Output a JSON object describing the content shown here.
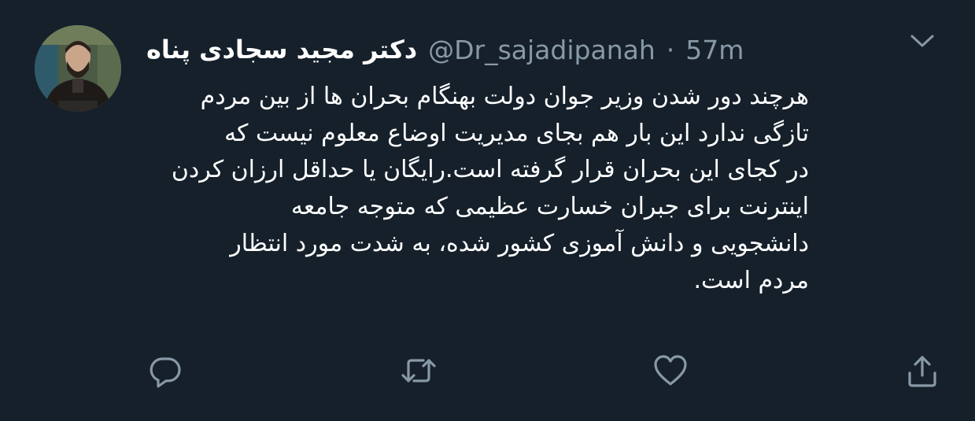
{
  "tweet": {
    "display_name": "دکتر مجید سجادی پناه",
    "handle": "@Dr_sajadipanah",
    "separator": "·",
    "time": "57m",
    "text": "هرچند دور شدن وزیر جوان دولت بهنگام بحران ها از بین مردم\nتازگی ندارد این بار هم بجای مدیریت اوضاع معلوم نیست که\nدر کجای این بحران قرار گرفته است.رایگان یا حداقل ارزان کردن\nاینترنت برای جبران خسارت عظیمی که متوجه جامعه\nدانشجویی و دانش آموزی کشور شده، به شدت مورد انتظار\nمردم است."
  },
  "colors": {
    "background": "#15202b",
    "text": "#ffffff",
    "secondary": "#8899a6"
  },
  "icons": {
    "avatar": "profile-photo",
    "more": "chevron-down-icon",
    "reply": "reply-icon",
    "retweet": "retweet-icon",
    "like": "like-icon",
    "share": "share-icon"
  }
}
